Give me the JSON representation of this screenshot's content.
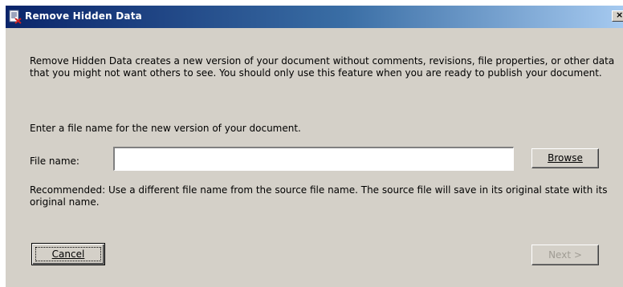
{
  "window": {
    "title": "Remove Hidden Data",
    "close_glyph": "×"
  },
  "content": {
    "description": "Remove Hidden Data creates a new version of your document without comments, revisions, file properties, or other data that you might not want others to see.  You should only use this feature when you are ready to publish your document.",
    "enter_prompt": "Enter a file name for the new version of your document.",
    "file_name_label": "File name:",
    "file_name_value": "",
    "file_name_placeholder": "",
    "recommendation": "Recommended: Use a different file name from the source file name. The source file will save in its original state with its original name."
  },
  "buttons": {
    "browse_label": "Browse",
    "cancel_label": "Cancel",
    "next_label": "Next >"
  },
  "icons": {
    "title_icon": "document-icon",
    "close_icon": "close-icon"
  },
  "colors": {
    "dialog_bg": "#d4d0c8",
    "title_start": "#0a246a",
    "title_end": "#a6caf0",
    "disabled_text": "#a09c94"
  }
}
